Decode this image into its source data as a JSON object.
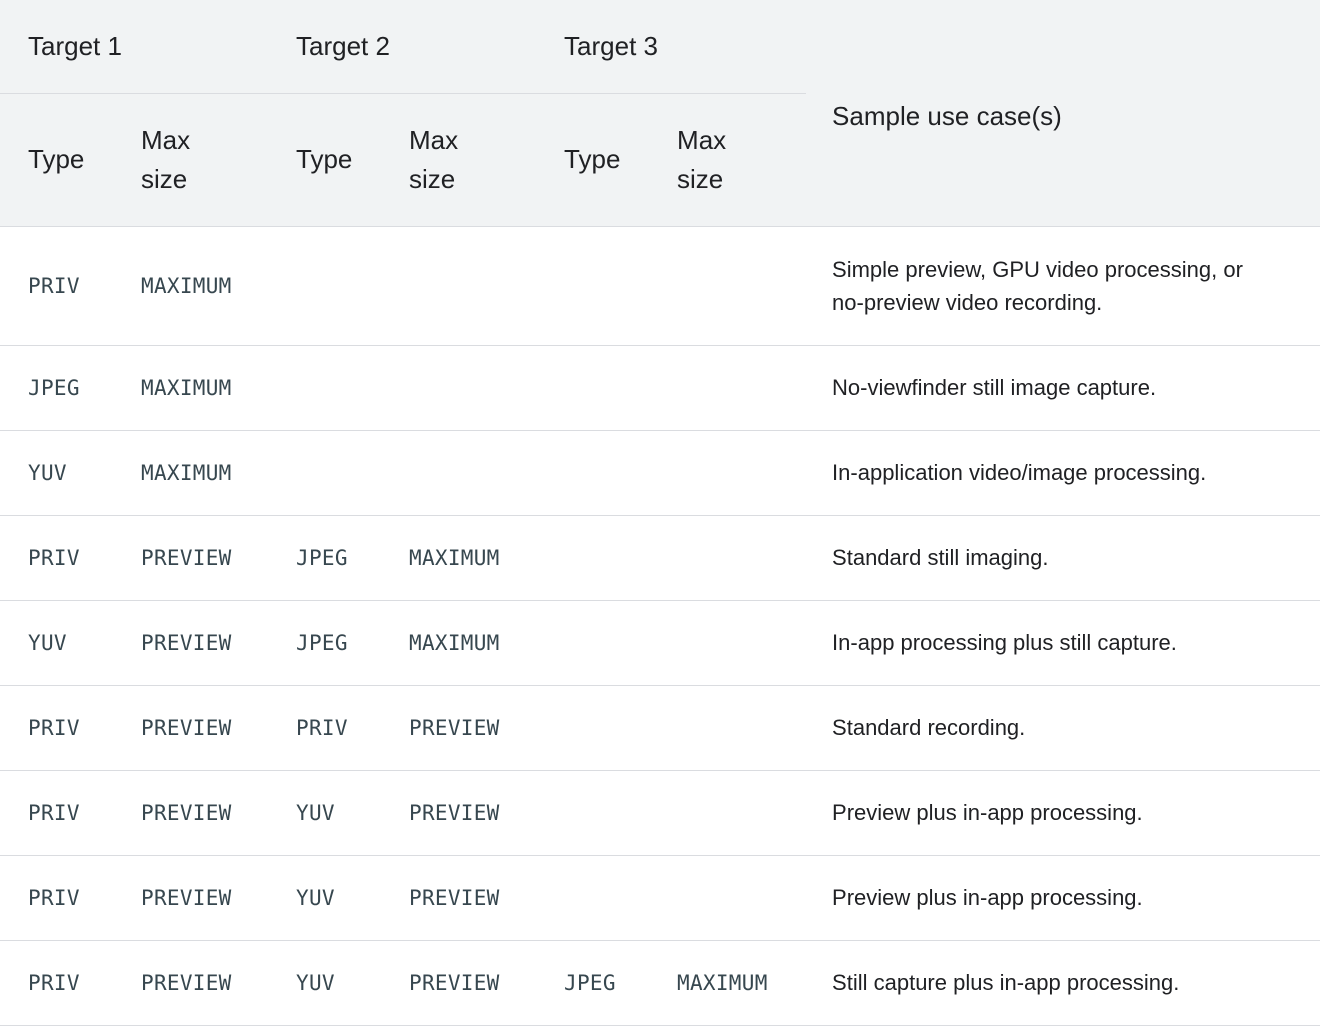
{
  "header": {
    "target1": "Target 1",
    "target2": "Target 2",
    "target3": "Target 3",
    "use_case": "Sample use case(s)",
    "type": "Type",
    "max_size_line1": "Max",
    "max_size_line2": "size"
  },
  "rows": [
    {
      "t1_type": "PRIV",
      "t1_size": "MAXIMUM",
      "t2_type": "",
      "t2_size": "",
      "t3_type": "",
      "t3_size": "",
      "use_case": "Simple preview, GPU video processing, or no-preview video recording."
    },
    {
      "t1_type": "JPEG",
      "t1_size": "MAXIMUM",
      "t2_type": "",
      "t2_size": "",
      "t3_type": "",
      "t3_size": "",
      "use_case": "No-viewfinder still image capture."
    },
    {
      "t1_type": "YUV",
      "t1_size": "MAXIMUM",
      "t2_type": "",
      "t2_size": "",
      "t3_type": "",
      "t3_size": "",
      "use_case": "In-application video/image processing."
    },
    {
      "t1_type": "PRIV",
      "t1_size": "PREVIEW",
      "t2_type": "JPEG",
      "t2_size": "MAXIMUM",
      "t3_type": "",
      "t3_size": "",
      "use_case": "Standard still imaging."
    },
    {
      "t1_type": "YUV",
      "t1_size": "PREVIEW",
      "t2_type": "JPEG",
      "t2_size": "MAXIMUM",
      "t3_type": "",
      "t3_size": "",
      "use_case": "In-app processing plus still capture."
    },
    {
      "t1_type": "PRIV",
      "t1_size": "PREVIEW",
      "t2_type": "PRIV",
      "t2_size": "PREVIEW",
      "t3_type": "",
      "t3_size": "",
      "use_case": "Standard recording."
    },
    {
      "t1_type": "PRIV",
      "t1_size": "PREVIEW",
      "t2_type": "YUV",
      "t2_size": "PREVIEW",
      "t3_type": "",
      "t3_size": "",
      "use_case": "Preview plus in-app processing."
    },
    {
      "t1_type": "PRIV",
      "t1_size": "PREVIEW",
      "t2_type": "YUV",
      "t2_size": "PREVIEW",
      "t3_type": "",
      "t3_size": "",
      "use_case": "Preview plus in-app processing."
    },
    {
      "t1_type": "PRIV",
      "t1_size": "PREVIEW",
      "t2_type": "YUV",
      "t2_size": "PREVIEW",
      "t3_type": "JPEG",
      "t3_size": "MAXIMUM",
      "use_case": "Still capture plus in-app processing."
    }
  ]
}
